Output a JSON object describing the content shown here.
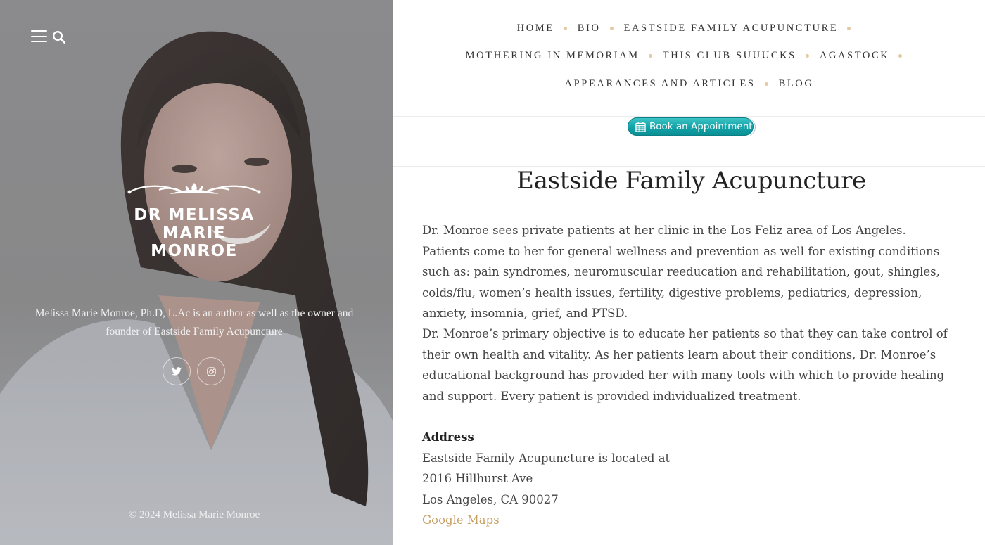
{
  "sidebar": {
    "logo": {
      "line1": "Dr Melissa",
      "line2": "Marie",
      "line3": "Monroe"
    },
    "tagline": "Melissa Marie Monroe, Ph.D, L.Ac is an author as well as the owner and founder of Eastside Family Acupuncture",
    "icons": {
      "menu": "hamburger-icon",
      "search": "search-icon",
      "twitter": "twitter-icon",
      "instagram": "instagram-icon"
    },
    "copyright": "© 2024 Melissa Marie Monroe"
  },
  "nav": {
    "items": [
      "HOME",
      "BIO",
      "EASTSIDE FAMILY ACUPUNCTURE",
      "MOTHERING IN MEMORIAM",
      "THIS CLUB SUUUCKS",
      "AGASTOCK",
      "APPEARANCES AND ARTICLES",
      "BLOG"
    ],
    "dot_color": "#e4c9a4"
  },
  "booking": {
    "label": "Book an Appointment",
    "icon": "calendar-icon",
    "color": "#11a3a8"
  },
  "page": {
    "title": "Eastside Family Acupuncture",
    "paragraph1": "Dr. Monroe sees private patients at her clinic in the Los Feliz area of Los Angeles.  Patients come to her for general wellness and prevention as well for existing conditions such as:  pain syndromes, neuromuscular reeducation and rehabilitation, gout, shingles, colds/flu, women’s health issues, fertility, digestive problems, pediatrics, depression, anxiety, insomnia, grief, and PTSD.",
    "paragraph2": "Dr. Monroe’s primary objective is to educate her patients so that they can take control of their own health and vitality.   As her patients learn about their conditions, Dr. Monroe’s educational background has provided her with many tools with which to provide healing and support.  Every patient is provided individualized treatment.",
    "address": {
      "heading": "Address",
      "intro": "Eastside Family Acupuncture is located at",
      "street": "2016 Hillhurst Ave",
      "city": "Los Angeles, CA 90027",
      "map_link": "Google Maps",
      "link_color": "#c8a063"
    }
  }
}
